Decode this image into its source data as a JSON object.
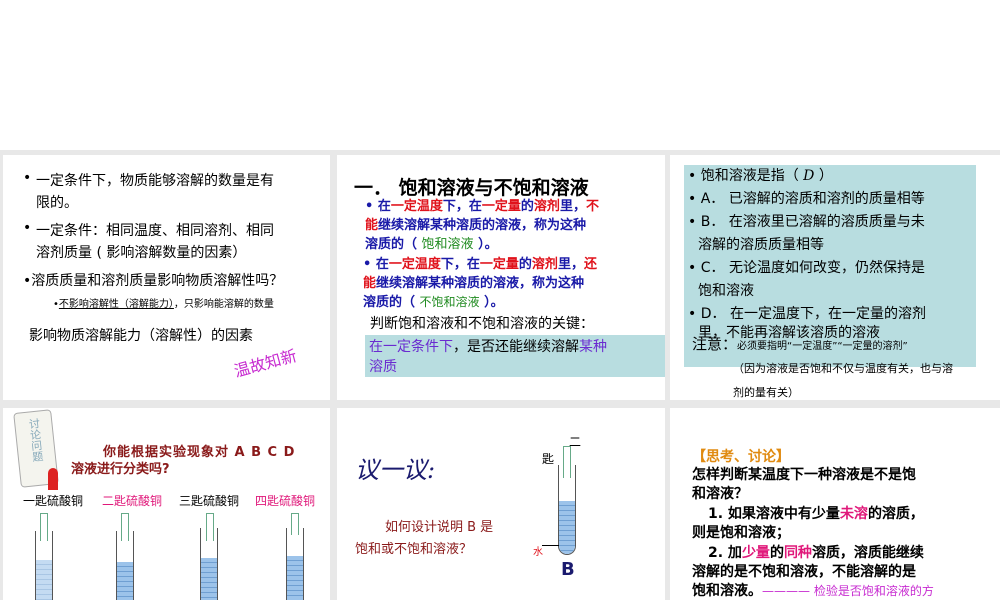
{
  "slide1": {
    "bullet1_line1": "一定条件下，物质能够溶解的数量是有",
    "bullet1_line2": "限的。",
    "bullet2_line1": "一定条件：相同温度、相同溶剂、相同",
    "bullet2_line2": "溶剂质量 ( 影响溶解数量的因素）",
    "bullet3": "溶质质量和溶剂质量影响物质溶解性吗？",
    "sub_underlined": "不影响溶解性（溶解能力）",
    "sub_rest": "，只影响能溶解的数量",
    "line4": "影响物质溶解能力（溶解性）的因素",
    "stamp": "温故知新"
  },
  "slide2": {
    "title": "一．  饱和溶液与不饱和溶液",
    "p1": [
      "在",
      "一定温度",
      "下，在",
      "一定量",
      "的",
      "溶剂",
      "里，",
      "不",
      "能",
      "继续溶解某种溶质的溶液，称为这种",
      "溶质的（ ",
      "饱和溶液",
      " ）。"
    ],
    "p2": [
      "在",
      "一定温度",
      "下，在",
      "一定量",
      "的",
      "溶剂",
      "里，",
      "还",
      "能",
      "继续溶解某种溶质的溶液，称为这种",
      "溶质的（ ",
      "不饱和溶液",
      " ）。"
    ],
    "key_label": "判断饱和溶液和不饱和溶液的关键：",
    "key_box": [
      "在一定条件下",
      "，是否还能继续溶解",
      "某种",
      "溶质"
    ]
  },
  "slide3": {
    "question": "饱和溶液是指（",
    "answer": "D",
    "question_end": "）",
    "optA": "A． 已溶解的溶质和溶剂的质量相等",
    "optB1": "B． 在溶液里已溶解的溶质质量与未",
    "optB2": "溶解的溶质质量相等",
    "optC1": "C． 无论温度如何改变，仍然保持是",
    "optC2": "饱和溶液",
    "optD1": "D． 在一定温度下，在一定量的溶剂",
    "optD2": "里，不能再溶解该溶质的溶液",
    "note_label": "注意：",
    "note_text": "必须要指明“一定温度”“一定量的溶剂”",
    "note2": "（因为溶液是否饱和不仅与温度有关，也与溶",
    "note3": "剂的量有关）"
  },
  "slide4": {
    "scroll_text": "讨论问题",
    "question1": "你能根据实验现象对 A B C D",
    "question2": "溶液进行分类吗?",
    "labels": [
      "一匙硫酸铜",
      "二匙硫酸铜",
      "三匙硫酸铜",
      "四匙硫酸铜"
    ]
  },
  "slide5": {
    "heading": "议一议:",
    "q1": "如何设计说明 B 是",
    "q2": "饱和或不饱和溶液？",
    "spoon1": "二",
    "spoon2": "匙",
    "water": "水",
    "tube_label": "B"
  },
  "slide6": {
    "heading": "【思考、讨论】",
    "q1": "怎样判断某温度下一种溶液是不是饱",
    "q2": "和溶液？",
    "i1a": "1. 如果溶液中有少量",
    "i1b": "未溶",
    "i1c": "的溶质，",
    "i1d": "则是饱和溶液；",
    "i2a": "2. 加",
    "i2b": "少量",
    "i2c": "的",
    "i2d": "同种",
    "i2e": "溶质，溶质能继续",
    "i2f": "溶解的是不饱和溶液，不能溶解的是",
    "i2g": "饱和溶液。",
    "i2h": "———— 检验是否饱和溶液的方"
  }
}
